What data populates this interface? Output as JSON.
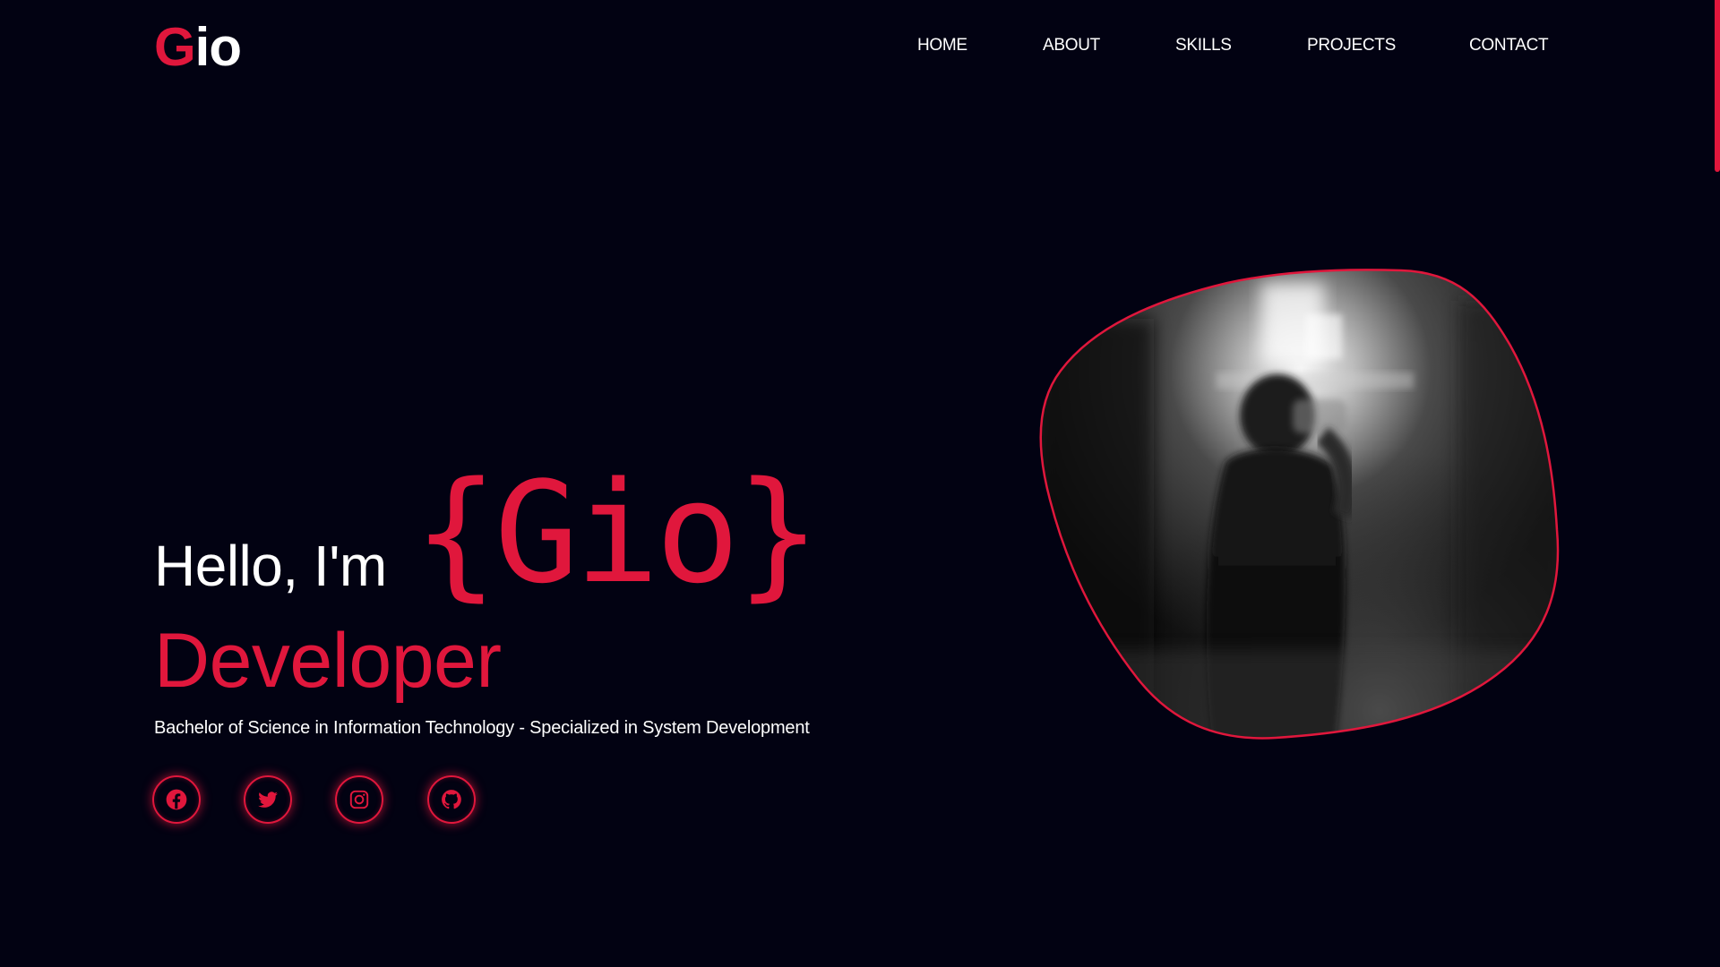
{
  "brand": {
    "logo_first": "G",
    "logo_rest": "io"
  },
  "nav": {
    "items": [
      "HOME",
      "ABOUT",
      "SKILLS",
      "PROJECTS",
      "CONTACT"
    ]
  },
  "hero": {
    "greeting": "Hello, I'm",
    "name": "{Gio}",
    "role": "Developer",
    "degree": "Bachelor of Science in Information Technology - Specialized in System Development"
  },
  "social": [
    {
      "icon": "facebook-icon"
    },
    {
      "icon": "twitter-icon"
    },
    {
      "icon": "instagram-icon"
    },
    {
      "icon": "github-icon"
    }
  ],
  "colors": {
    "background": "#020212",
    "accent": "#e0173c",
    "text": "#ffffff"
  }
}
